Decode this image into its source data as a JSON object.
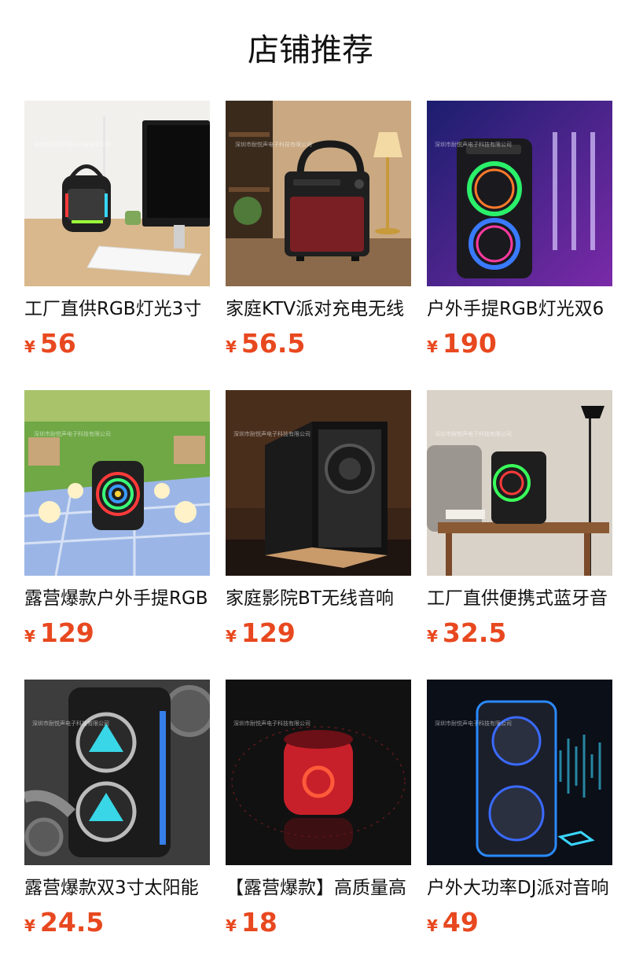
{
  "section": {
    "title": "店铺推荐"
  },
  "currency_symbol": "¥",
  "watermark": "深圳市耐悦声电子科技有限公司",
  "products": [
    {
      "name": "工厂直供RGB灯光3寸",
      "price": "56",
      "icon": "desk-speaker-image"
    },
    {
      "name": "家庭KTV派对充电无线",
      "price": "56.5",
      "icon": "ktv-speaker-image"
    },
    {
      "name": "户外手提RGB灯光双6",
      "price": "190",
      "icon": "party-speaker-image"
    },
    {
      "name": "露营爆款户外手提RGB",
      "price": "129",
      "icon": "camping-speaker-image"
    },
    {
      "name": "家庭影院BT无线音响",
      "price": "129",
      "icon": "home-theater-speaker-image"
    },
    {
      "name": "工厂直供便携式蓝牙音",
      "price": "32.5",
      "icon": "portable-speaker-image"
    },
    {
      "name": "露营爆款双3寸太阳能",
      "price": "24.5",
      "icon": "solar-speaker-image"
    },
    {
      "name": "【露营爆款】高质量高",
      "price": "18",
      "icon": "mini-speaker-image"
    },
    {
      "name": "户外大功率DJ派对音响",
      "price": "49",
      "icon": "dj-speaker-image"
    }
  ]
}
